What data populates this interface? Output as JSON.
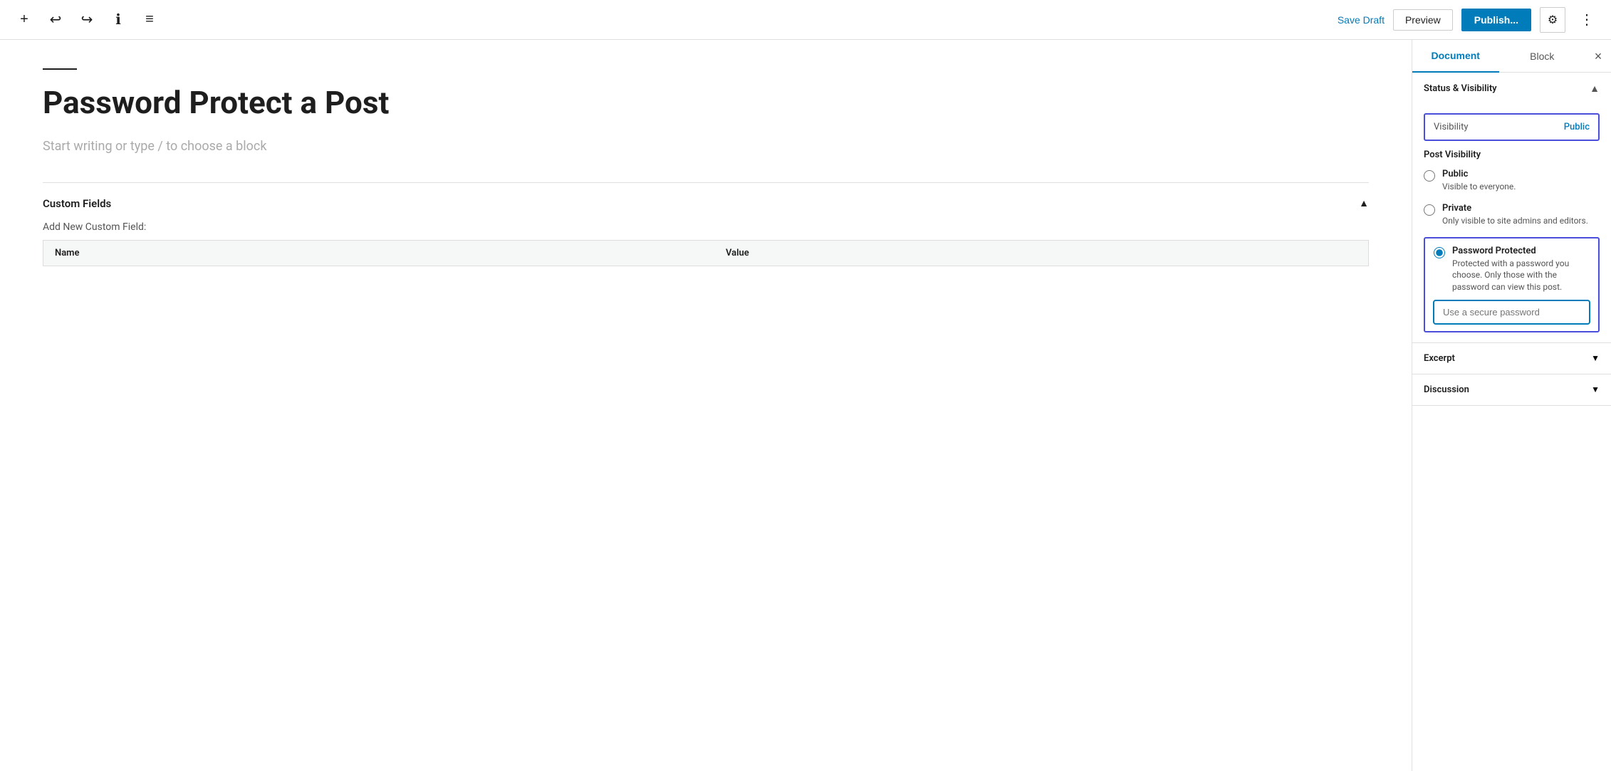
{
  "toolbar": {
    "save_draft_label": "Save Draft",
    "preview_label": "Preview",
    "publish_label": "Publish...",
    "icons": {
      "add": "+",
      "undo": "↩",
      "redo": "↪",
      "info": "ℹ",
      "menu": "≡",
      "settings": "⚙",
      "more": "⋮"
    }
  },
  "editor": {
    "title": "Password Protect a Post",
    "placeholder": "Start writing or type / to choose a block",
    "custom_fields": {
      "header": "Custom Fields",
      "add_new_label": "Add New Custom Field:",
      "col_name": "Name",
      "col_value": "Value"
    }
  },
  "sidebar": {
    "tabs": [
      {
        "label": "Document",
        "active": true
      },
      {
        "label": "Block",
        "active": false
      }
    ],
    "close_label": "×",
    "panels": {
      "status_visibility": {
        "title": "Status & Visibility",
        "expanded": true,
        "visibility": {
          "label": "Visibility",
          "value": "Public"
        },
        "post_visibility": {
          "title": "Post Visibility",
          "options": [
            {
              "label": "Public",
              "desc": "Visible to everyone.",
              "value": "public",
              "checked": false
            },
            {
              "label": "Private",
              "desc": "Only visible to site admins and editors.",
              "value": "private",
              "checked": false
            },
            {
              "label": "Password Protected",
              "desc": "Protected with a password you choose. Only those with the password can view this post.",
              "value": "password",
              "checked": true
            }
          ],
          "password_placeholder": "Use a secure password"
        }
      },
      "excerpt": {
        "title": "Excerpt",
        "expanded": false
      },
      "discussion": {
        "title": "Discussion",
        "expanded": false
      }
    }
  }
}
